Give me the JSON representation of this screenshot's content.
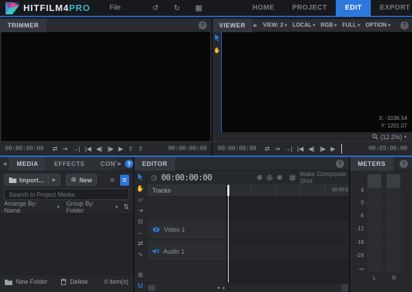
{
  "ui": {
    "caret": "▾",
    "scroll_left": "◀",
    "scroll_right": "▶"
  },
  "titlebar": {
    "logo_text": "HITFILM4",
    "logo_accent": "PRO",
    "file_menu": "File",
    "icons": {
      "undo": "↺",
      "redo": "↻",
      "grid": "▦"
    },
    "nav_tabs": [
      {
        "label": "HOME"
      },
      {
        "label": "PROJECT"
      },
      {
        "label": "EDIT"
      },
      {
        "label": "EXPORT"
      }
    ],
    "window": {
      "minimize": "–",
      "maximize": "□",
      "close": "✕"
    }
  },
  "trimmer": {
    "title": "TRIMMER",
    "help": "?",
    "timecode_in": "00:00:00:00",
    "timecode_out": "00:00:00:00",
    "transport": [
      "⇄",
      "⇥",
      "→|",
      "|◀",
      "◀|",
      "|▶",
      "▶"
    ],
    "insert": [
      "⇧",
      "⇪"
    ]
  },
  "viewer": {
    "title": "VIEWER",
    "expand": "▶",
    "help": "?",
    "dropdowns": [
      "VIEW: 2",
      "LOCAL",
      "RGB",
      "FULL",
      "OPTION"
    ],
    "tools": [
      "✋"
    ],
    "coord_x": "X: -1036.54",
    "coord_y": "Y: 1201.07",
    "zoom_level": "(12.2%)",
    "timecode_current": "00:00:00:00",
    "timecode_end": "00:05:00:00",
    "transport": [
      "⇄",
      "⇥",
      "→|",
      "|◀",
      "◀|",
      "|▶",
      "▶"
    ]
  },
  "media": {
    "tabs": [
      "MEDIA",
      "EFFECTS",
      "CONTROL"
    ],
    "help": "?",
    "import_label": "Import...",
    "new_icon": "⊕",
    "new_label": "New",
    "list_view_icon": "≡",
    "detail_view_icon": "≡",
    "search_placeholder": "Search in Project Media",
    "arrange_label": "Arrange By: Name",
    "group_label": "Group By: Folder",
    "sort_icon": "⇅",
    "new_folder_label": "New Folder",
    "delete_label": "Delete",
    "item_count": "0 item(s)"
  },
  "editor": {
    "title": "EDITOR",
    "help": "?",
    "clock_icon": "◷",
    "timecode": "00:00:00:00",
    "range_buttons": [
      "⊕",
      "◎",
      "⊕"
    ],
    "slate_icon": "▦",
    "make_composite_label": "Make Composite Shot",
    "tracks_label": "Tracks",
    "ruler_end": "00:05:0",
    "video_track": "Video 1",
    "audio_track": "Audio 1",
    "tools": [
      "✋",
      "▱",
      "⇥",
      "⊟",
      "↔",
      "⇄",
      "∿"
    ],
    "grid_toggle": "⊞",
    "u_tool": "U",
    "zoom_small": "▲",
    "zoom_arrow": "▸"
  },
  "meters": {
    "title": "METERS",
    "help": "?",
    "scale": [
      "6",
      "0",
      "-6",
      "-12",
      "-18",
      "-24",
      "-∞"
    ],
    "channel_left": "L",
    "channel_right": "R"
  },
  "colors": {
    "accent": "#2e77dd",
    "logo_teal": "#36b7c8"
  }
}
